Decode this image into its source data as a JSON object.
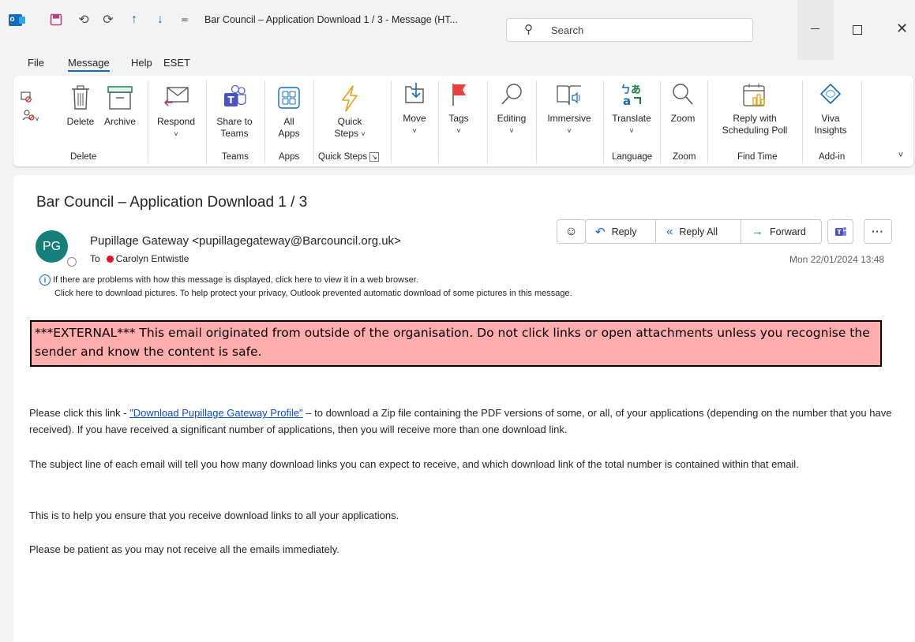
{
  "titlebar": {
    "title": "Bar Council – Application Download 1 / 3  -  Message (HT...",
    "search_placeholder": "Search",
    "qat_icons": [
      "outlook-logo-icon",
      "save-icon",
      "undo-icon",
      "redo-icon",
      "up-arrow-icon",
      "down-arrow-icon",
      "customize-qat-icon"
    ]
  },
  "menu": [
    "File",
    "Message",
    "Help",
    "ESET"
  ],
  "ribbon": {
    "delete": "Delete",
    "archive": "Archive",
    "respond": "Respond",
    "share_to_teams": [
      "Share to",
      "Teams"
    ],
    "all_apps": [
      "All",
      "Apps"
    ],
    "quick_steps": [
      "Quick",
      "Steps"
    ],
    "move": "Move",
    "tags": "Tags",
    "editing": "Editing",
    "immersive": "Immersive",
    "translate": "Translate",
    "zoom": "Zoom",
    "reply_poll": [
      "Reply with",
      "Scheduling Poll"
    ],
    "viva": [
      "Viva",
      "Insights"
    ],
    "groups": {
      "delete": "Delete",
      "teams": "Teams",
      "apps": "Apps",
      "quick_steps": "Quick Steps",
      "language": "Language",
      "zoom": "Zoom",
      "find_time": "Find Time",
      "addin": "Add-in"
    }
  },
  "message": {
    "subject": "Bar Council – Application Download 1 / 3",
    "avatar_initials": "PG",
    "from": "Pupillage Gateway <pupillagegateway@Barcouncil.org.uk>",
    "to_label": "To",
    "to_name": "Carolyn Entwistle",
    "date": "Mon 22/01/2024 13:48",
    "actions": {
      "reply": "Reply",
      "reply_all": "Reply All",
      "forward": "Forward"
    },
    "info_line1": "If there are problems with how this message is displayed, click here to view it in a web browser.",
    "info_line2": "Click here to download pictures. To help protect your privacy, Outlook prevented automatic download of some pictures in this message.",
    "warning": "***EXTERNAL*** This email originated from outside of the organisation. Do not click links or open attachments unless you recognise the sender and know the content is safe.",
    "p1_before": "Please click this link - ",
    "p1_link": "\"Download Pupillage Gateway Profile\"",
    "p1_after": " – to download a Zip file containing the PDF versions of some, or all, of your applications (depending on the number that you have received). If you have received a significant number of applications, then you will receive more than one download link.",
    "p2": "The subject line of each email will tell you how many download links you can expect to receive, and which download link of the total number is contained within that email.",
    "p3": "This is to help you ensure that you receive download links to all your applications.",
    "p4": "Please be patient as you may not receive all the emails immediately."
  }
}
